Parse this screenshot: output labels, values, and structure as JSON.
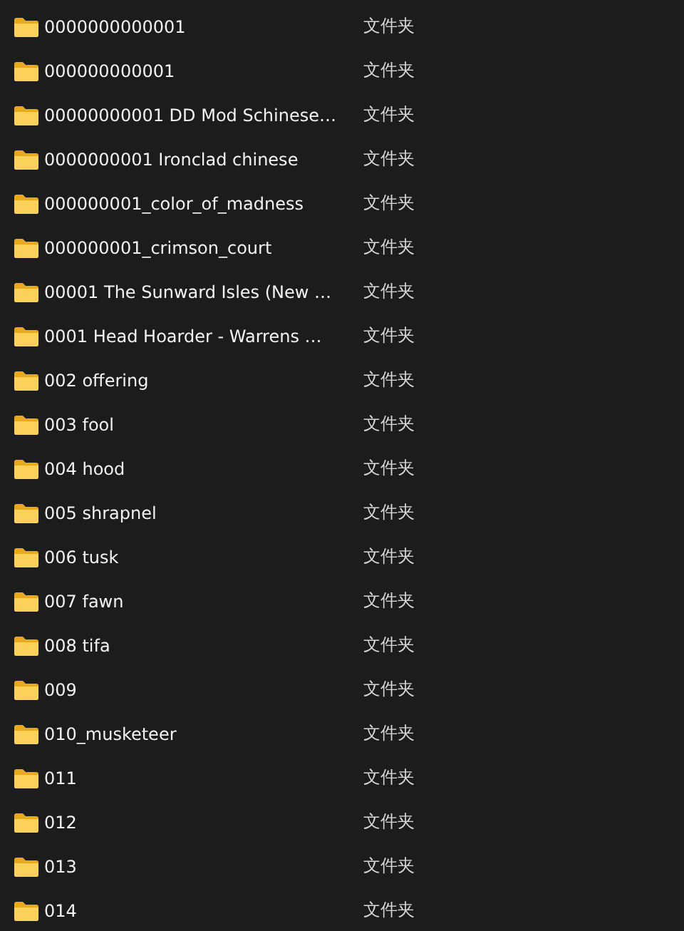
{
  "rows": [
    {
      "name": "0000000000001",
      "type": "文件夹"
    },
    {
      "name": "000000000001",
      "type": "文件夹"
    },
    {
      "name": "00000000001 DD Mod Schinese…",
      "type": "文件夹"
    },
    {
      "name": "0000000001 Ironclad chinese",
      "type": "文件夹"
    },
    {
      "name": "000000001_color_of_madness",
      "type": "文件夹"
    },
    {
      "name": "000000001_crimson_court",
      "type": "文件夹"
    },
    {
      "name": "00001 The Sunward Isles (New …",
      "type": "文件夹"
    },
    {
      "name": "0001 Head Hoarder - Warrens …",
      "type": "文件夹"
    },
    {
      "name": "002 offering",
      "type": "文件夹"
    },
    {
      "name": "003 fool",
      "type": "文件夹"
    },
    {
      "name": "004 hood",
      "type": "文件夹"
    },
    {
      "name": "005 shrapnel",
      "type": "文件夹"
    },
    {
      "name": "006 tusk",
      "type": "文件夹"
    },
    {
      "name": "007 fawn",
      "type": "文件夹"
    },
    {
      "name": "008 tifa",
      "type": "文件夹"
    },
    {
      "name": "009",
      "type": "文件夹"
    },
    {
      "name": "010_musketeer",
      "type": "文件夹"
    },
    {
      "name": "011",
      "type": "文件夹"
    },
    {
      "name": "012",
      "type": "文件夹"
    },
    {
      "name": "013",
      "type": "文件夹"
    },
    {
      "name": "014",
      "type": "文件夹"
    }
  ]
}
